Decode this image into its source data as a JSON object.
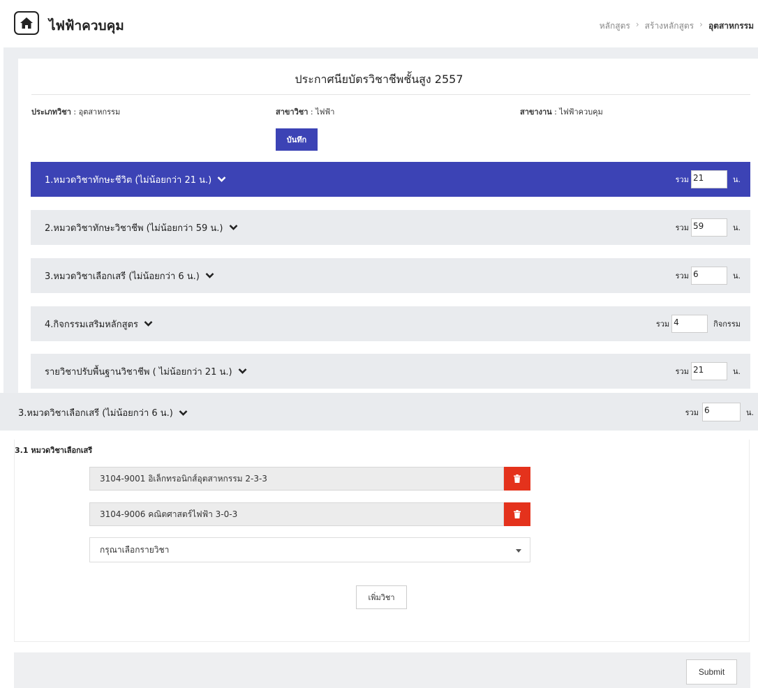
{
  "header": {
    "home_icon": "home-icon",
    "title": "ไฟฟ้าควบคุม",
    "breadcrumb": [
      "หลักสูตร",
      "สร้างหลักสูตร",
      "อุตสาหกรรม"
    ]
  },
  "card": {
    "title": "ประกาศนียบัตรวิชาชีพชั้นสูง 2557",
    "meta": [
      {
        "label": "ประเภทวิชา",
        "value": "อุตสาหกรรม"
      },
      {
        "label": "สาขาวิชา",
        "value": "ไฟฟ้า"
      },
      {
        "label": "สาขางาน",
        "value": "ไฟฟ้าควบคุม"
      }
    ],
    "save_label": "บันทึก"
  },
  "sections": [
    {
      "label": "1.หมวดวิชาทักษะชีวิต (ไม่น้อยกว่า 21 น.)",
      "total_label": "รวม",
      "value": "21",
      "unit": "น.",
      "active": true
    },
    {
      "label": "2.หมวดวิชาทักษะวิชาชีพ (ไม่น้อยกว่า 59 น.)",
      "total_label": "รวม",
      "value": "59",
      "unit": "น.",
      "active": false
    },
    {
      "label": "3.หมวดวิชาเลือกเสรี (ไม่น้อยกว่า 6 น.)",
      "total_label": "รวม",
      "value": "6",
      "unit": "น.",
      "active": false
    },
    {
      "label": "4.กิจกรรมเสริมหลักสูตร",
      "total_label": "รวม",
      "value": "4",
      "unit": "กิจกรรม",
      "active": false
    },
    {
      "label": "รายวิชาปรับพื้นฐานวิชาชีพ ( ไม่น้อยกว่า 21 น.)",
      "total_label": "รวม",
      "value": "21",
      "unit": "น.",
      "active": false
    }
  ],
  "detail": {
    "label": "3.หมวดวิชาเลือกเสรี (ไม่น้อยกว่า 6 น.)",
    "total_label": "รวม",
    "value": "6",
    "unit": "น.",
    "subsection_title": "3.1 หมวดวิชาเลือกเสรี",
    "courses": [
      "3104-9001 อิเล็กทรอนิกส์อุตสาหกรรม 2-3-3",
      "3104-9006 คณิตศาสตร์ไฟฟ้า 3-0-3"
    ],
    "select_placeholder": "กรุณาเลือกรายวิชา",
    "add_label": "เพิ่มวิชา"
  },
  "footer": {
    "submit_label": "Submit"
  },
  "colors": {
    "accent": "#3c43b5",
    "danger": "#e4321c",
    "panel_gray": "#e9ebee"
  }
}
